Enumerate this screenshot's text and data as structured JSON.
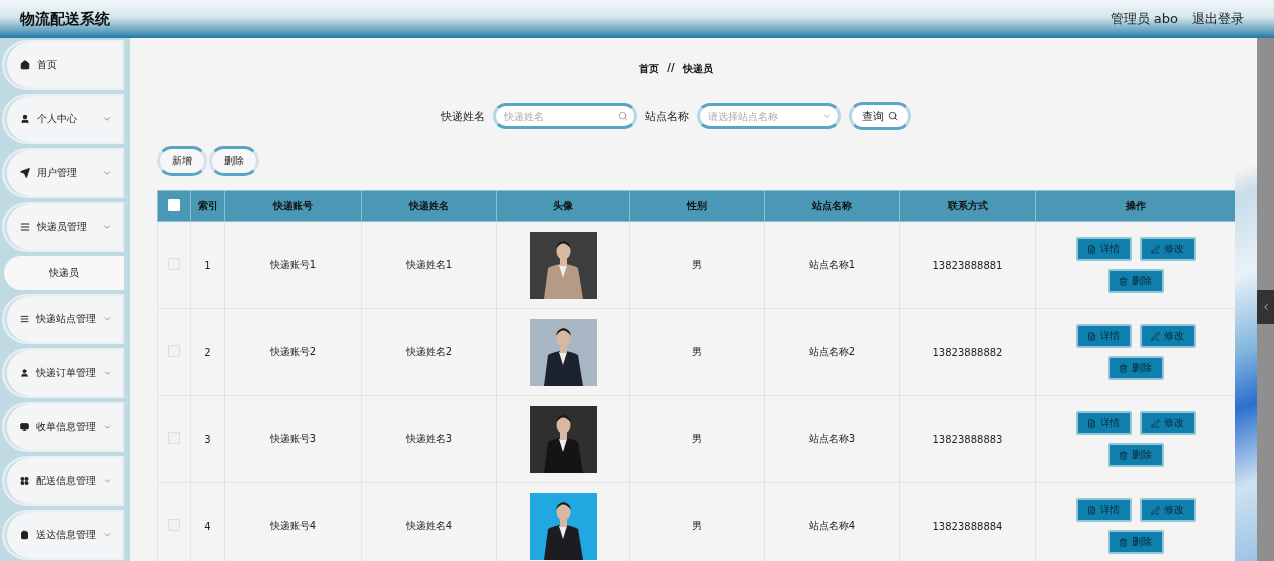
{
  "header": {
    "title": "物流配送系统",
    "user": "管理员 abo",
    "logout": "退出登录"
  },
  "sidebar": {
    "items": [
      {
        "label": "首页",
        "kind": "link"
      },
      {
        "label": "个人中心",
        "kind": "group"
      },
      {
        "label": "用户管理",
        "kind": "group"
      },
      {
        "label": "快递员管理",
        "kind": "group",
        "children": [
          {
            "label": "快递员",
            "selected": true
          }
        ]
      },
      {
        "label": "快递站点管理",
        "kind": "group"
      },
      {
        "label": "快递订单管理",
        "kind": "group"
      },
      {
        "label": "收单信息管理",
        "kind": "group"
      },
      {
        "label": "配送信息管理",
        "kind": "group"
      },
      {
        "label": "送达信息管理",
        "kind": "group"
      }
    ]
  },
  "breadcrumb": {
    "home": "首页",
    "separator": "//",
    "current": "快递员"
  },
  "search": {
    "name_label": "快递姓名",
    "name_placeholder": "快递姓名",
    "station_label": "站点名称",
    "station_placeholder": "请选择站点名称",
    "query_button": "查询"
  },
  "actions": [
    "新增",
    "删除"
  ],
  "table": {
    "header_checked": false,
    "columns": [
      "索引",
      "快递账号",
      "快递姓名",
      "头像",
      "性别",
      "站点名称",
      "联系方式",
      "操作"
    ],
    "rows": [
      {
        "checked": false,
        "index": "1",
        "account": "快递账号1",
        "name": "快递姓名1",
        "avatar": {
          "kind": "picture"
        },
        "gender": "男",
        "station": "站点名称1",
        "phone": "13823888881",
        "buttons": [
          {
            "kind": "detail",
            "label": "详情"
          },
          {
            "kind": "edit",
            "label": "修改"
          },
          {
            "kind": "delete",
            "label": "删除"
          }
        ]
      },
      {
        "checked": false,
        "index": "2",
        "account": "快递账号2",
        "name": "快递姓名2",
        "avatar": {
          "kind": "picture"
        },
        "gender": "男",
        "station": "站点名称2",
        "phone": "13823888882",
        "buttons": [
          {
            "kind": "detail",
            "label": "详情"
          },
          {
            "kind": "edit",
            "label": "修改"
          },
          {
            "kind": "delete",
            "label": "删除"
          }
        ]
      },
      {
        "checked": false,
        "index": "3",
        "account": "快递账号3",
        "name": "快递姓名3",
        "avatar": {
          "kind": "picture"
        },
        "gender": "男",
        "station": "站点名称3",
        "phone": "13823888883",
        "buttons": [
          {
            "kind": "detail",
            "label": "详情"
          },
          {
            "kind": "edit",
            "label": "修改"
          },
          {
            "kind": "delete",
            "label": "删除"
          }
        ]
      },
      {
        "checked": false,
        "index": "4",
        "account": "快递账号4",
        "name": "快递姓名4",
        "avatar": {
          "kind": "picture"
        },
        "gender": "男",
        "station": "站点名称4",
        "phone": "13823888884",
        "buttons": [
          {
            "kind": "detail",
            "label": "详情"
          },
          {
            "kind": "edit",
            "label": "修改"
          },
          {
            "kind": "delete",
            "label": "删除"
          }
        ]
      }
    ]
  }
}
